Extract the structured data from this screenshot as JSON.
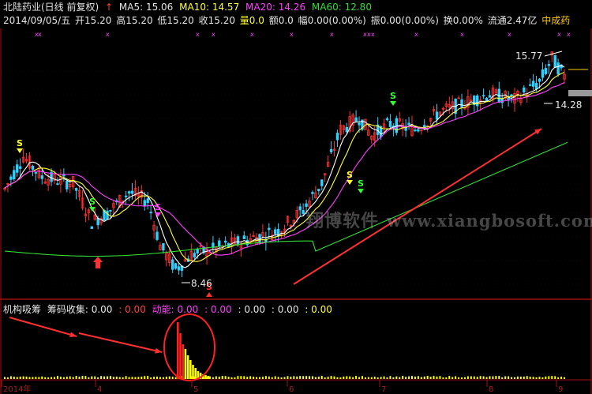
{
  "header": {
    "stock_name": "北陆药业(日线 前复权)",
    "ma5": "MA5: 15.06",
    "ma10": "MA10: 14.57",
    "ma20": "MA20: 14.26",
    "ma60": "MA60: 12.80",
    "date": "2014/09/05/五",
    "open": "开15.20",
    "high": "高15.20",
    "low": "低15.20",
    "close": "收15.20",
    "volume": "量0.0",
    "amount": "额0.0",
    "range": "幅0.00(0.00%)",
    "amplitude": "振0.00(0.00%)",
    "turnover": "换0.00%",
    "float_cap": "流通2.47亿",
    "sector": "中成药"
  },
  "indicator": {
    "name": "机构吸筹",
    "collect_label": "筹码收集: 0.00",
    "v2": ": 0.00",
    "power_label": "动能: 0.00",
    "v4": ": 0.00",
    "v5": ": 0.00",
    "v6": ": 0.00",
    "v7": ": 0.00"
  },
  "annotations": {
    "high_price": "15.77",
    "low_price": "8.46",
    "current_price": "14.28"
  },
  "watermark": {
    "cn": "翔博软件",
    "url": "www.xiangbosoft.com"
  },
  "signals": {
    "s": "S",
    "marker": "x"
  },
  "colors": {
    "background": "#000000",
    "up": "#ff3030",
    "down": "#30d0ff",
    "ma5": "#ffffff",
    "ma10": "#ffff33",
    "ma20": "#ff40ff",
    "ma60": "#33dd33",
    "volume_bar": "#ffff00",
    "arrow": "#ff3030"
  },
  "x_axis_labels": [
    "2014年",
    "4",
    "5",
    "6",
    "7",
    "8",
    "9"
  ]
}
